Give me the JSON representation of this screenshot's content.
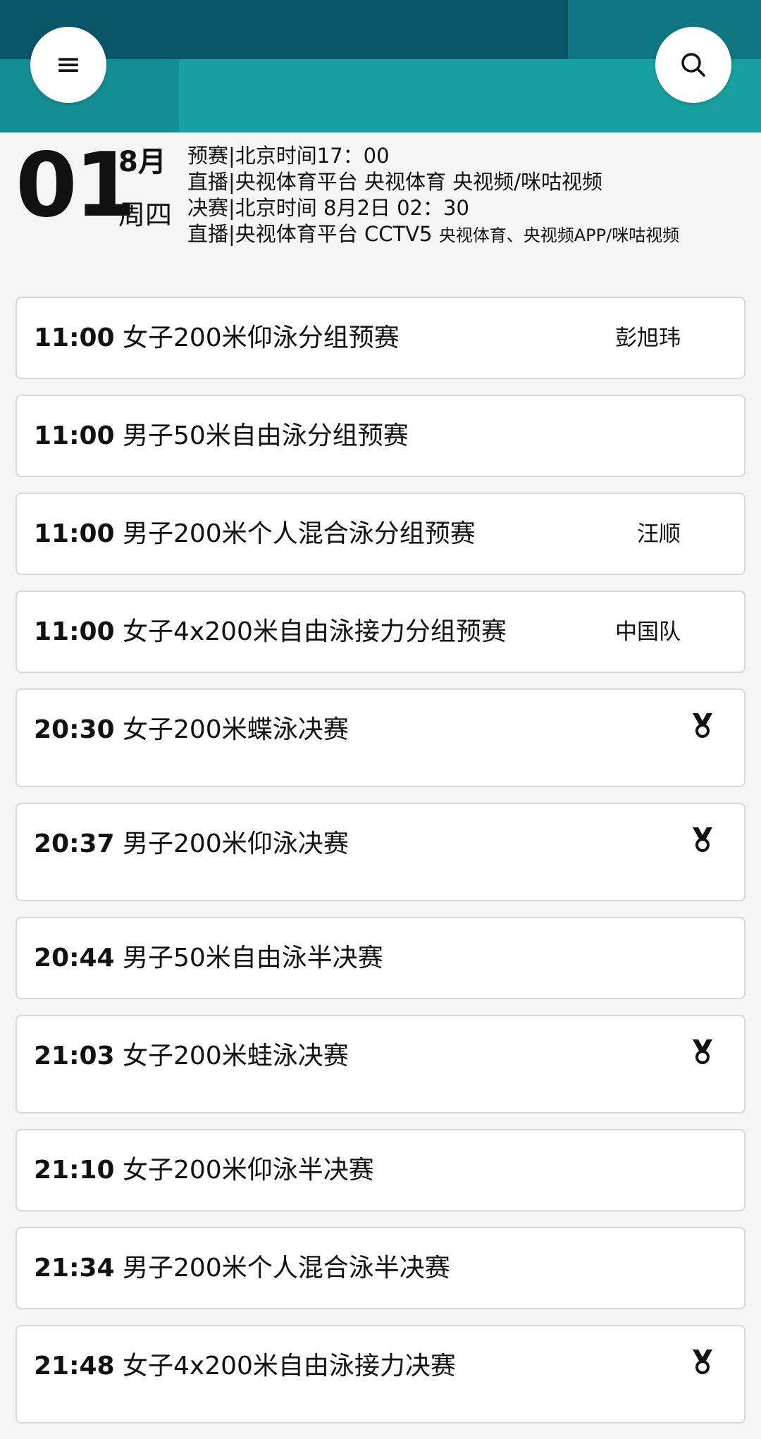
{
  "header": {
    "colors": {
      "dark": "#0a5566",
      "mid": "#0d7680",
      "teal": "#17a09f",
      "left": "#138f93"
    },
    "menu_icon": "hamburger-menu-icon",
    "search_icon": "search-icon"
  },
  "date": {
    "day": "01",
    "month": "8月",
    "weekday": "周四"
  },
  "broadcast": {
    "line1": "预赛|北京时间17：00",
    "line2": "直播|央视体育平台 央视体育 央视频/咪咕视频",
    "line3": "决赛|北京时间 8月2日 02：30",
    "line4": "直播|央视体育平台 CCTV5",
    "line4_small": "央视体育、央视频APP/咪咕视频"
  },
  "events": [
    {
      "time": "11:00",
      "name": "女子200米仰泳分组预赛",
      "athlete": "彭旭玮",
      "medal": false
    },
    {
      "time": "11:00",
      "name": "男子50米自由泳分组预赛",
      "athlete": "",
      "medal": false
    },
    {
      "time": "11:00",
      "name": "男子200米个人混合泳分组预赛",
      "athlete": "汪顺",
      "medal": false
    },
    {
      "time": "11:00",
      "name": "女子4x200米自由泳接力分组预赛",
      "athlete": "中国队",
      "medal": false
    },
    {
      "time": "20:30",
      "name": "女子200米蝶泳决赛",
      "athlete": "",
      "medal": true
    },
    {
      "time": "20:37",
      "name": "男子200米仰泳决赛",
      "athlete": "",
      "medal": true
    },
    {
      "time": "20:44",
      "name": "男子50米自由泳半决赛",
      "athlete": "",
      "medal": false
    },
    {
      "time": "21:03",
      "name": "女子200米蛙泳决赛",
      "athlete": "",
      "medal": true
    },
    {
      "time": "21:10",
      "name": "女子200米仰泳半决赛",
      "athlete": "",
      "medal": false
    },
    {
      "time": "21:34",
      "name": "男子200米个人混合泳半决赛",
      "athlete": "",
      "medal": false
    },
    {
      "time": "21:48",
      "name": "女子4x200米自由泳接力决赛",
      "athlete": "",
      "medal": true
    }
  ]
}
